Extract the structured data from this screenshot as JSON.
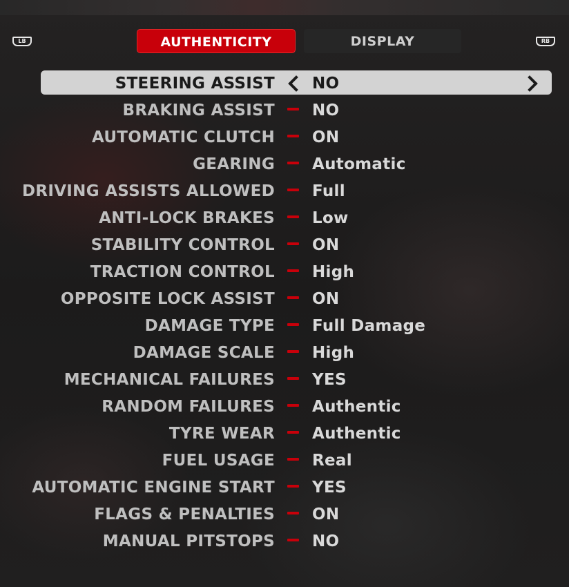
{
  "header": {
    "left_bumper": "LB",
    "right_bumper": "RB",
    "tabs": [
      {
        "label": "AUTHENTICITY",
        "active": true
      },
      {
        "label": "DISPLAY",
        "active": false
      }
    ]
  },
  "colors": {
    "accent_red": "#c8000a",
    "highlight": "#d3d3d3",
    "label_text": "#bfbfbf",
    "value_text": "#d9d9d9"
  },
  "selected_row_index": 0,
  "settings": [
    {
      "label": "STEERING ASSIST",
      "value": "NO"
    },
    {
      "label": "BRAKING ASSIST",
      "value": "NO"
    },
    {
      "label": "AUTOMATIC CLUTCH",
      "value": "ON"
    },
    {
      "label": "GEARING",
      "value": "Automatic"
    },
    {
      "label": "DRIVING ASSISTS ALLOWED",
      "value": "Full"
    },
    {
      "label": "ANTI-LOCK BRAKES",
      "value": "Low"
    },
    {
      "label": "STABILITY CONTROL",
      "value": "ON"
    },
    {
      "label": "TRACTION CONTROL",
      "value": "High"
    },
    {
      "label": "OPPOSITE LOCK ASSIST",
      "value": "ON"
    },
    {
      "label": "DAMAGE TYPE",
      "value": "Full Damage"
    },
    {
      "label": "DAMAGE SCALE",
      "value": "High"
    },
    {
      "label": "MECHANICAL FAILURES",
      "value": "YES"
    },
    {
      "label": "RANDOM FAILURES",
      "value": "Authentic"
    },
    {
      "label": "TYRE WEAR",
      "value": "Authentic"
    },
    {
      "label": "FUEL USAGE",
      "value": "Real"
    },
    {
      "label": "AUTOMATIC ENGINE START",
      "value": "YES"
    },
    {
      "label": "FLAGS & PENALTIES",
      "value": "ON"
    },
    {
      "label": "MANUAL PITSTOPS",
      "value": "NO"
    }
  ]
}
